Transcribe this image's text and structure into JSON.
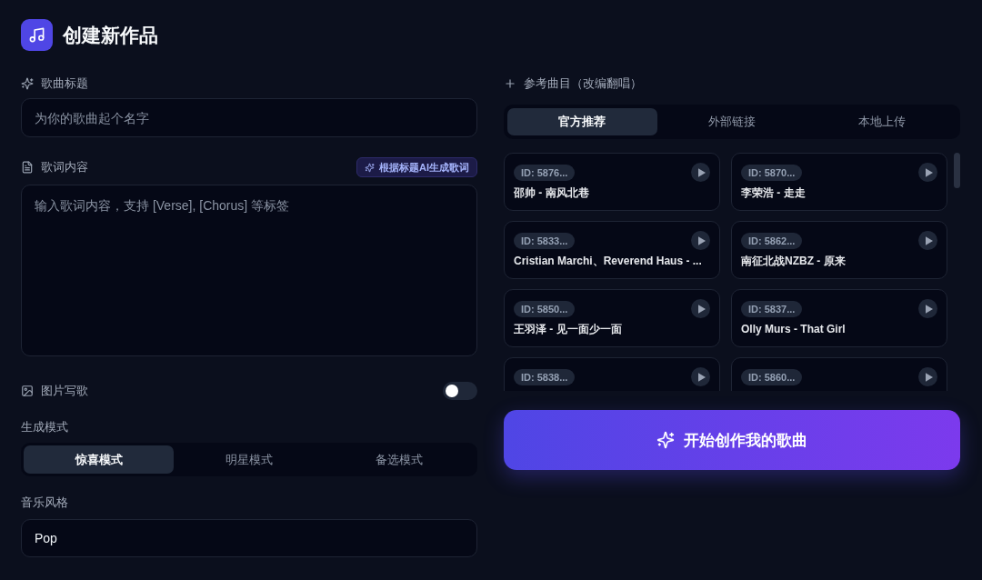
{
  "header": {
    "title": "创建新作品"
  },
  "form": {
    "song_title": {
      "label": "歌曲标题",
      "placeholder": "为你的歌曲起个名字"
    },
    "lyrics": {
      "label": "歌词内容",
      "ai_button": "根据标题AI生成歌词",
      "placeholder": "输入歌词内容，支持 [Verse], [Chorus] 等标签"
    },
    "image_to_song": {
      "label": "图片写歌",
      "on": false
    },
    "mode": {
      "label": "生成模式",
      "options": [
        {
          "label": "惊喜模式",
          "selected": true
        },
        {
          "label": "明星模式",
          "selected": false
        },
        {
          "label": "备选模式",
          "selected": false
        }
      ]
    },
    "style": {
      "label": "音乐风格",
      "value": "Pop"
    }
  },
  "reference": {
    "label": "参考曲目（改编翻唱）",
    "tabs": [
      {
        "label": "官方推荐",
        "selected": true
      },
      {
        "label": "外部链接",
        "selected": false
      },
      {
        "label": "本地上传",
        "selected": false
      }
    ],
    "tracks": [
      {
        "id": "ID: 5876...",
        "title": "邵帅 - 南风北巷"
      },
      {
        "id": "ID: 5870...",
        "title": "李荣浩 - 走走"
      },
      {
        "id": "ID: 5833...",
        "title": "Cristian Marchi、Reverend Haus - ..."
      },
      {
        "id": "ID: 5862...",
        "title": "南征北战NZBZ - 原来"
      },
      {
        "id": "ID: 5850...",
        "title": "王羽泽 - 见一面少一面"
      },
      {
        "id": "ID: 5837...",
        "title": "Olly Murs - That Girl"
      },
      {
        "id": "ID: 5838..."
      },
      {
        "id": "ID: 5860..."
      }
    ]
  },
  "submit_button": {
    "label": "开始创作我的歌曲"
  }
}
